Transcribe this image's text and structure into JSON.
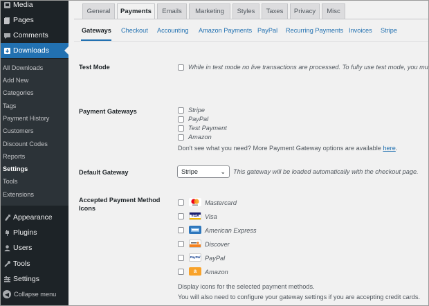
{
  "sidebar": {
    "top": [
      {
        "label": "Media",
        "icon": "media-icon"
      },
      {
        "label": "Pages",
        "icon": "pages-icon"
      },
      {
        "label": "Comments",
        "icon": "comments-icon"
      },
      {
        "label": "Downloads",
        "icon": "downloads-icon",
        "active": true
      }
    ],
    "submenu": [
      "All Downloads",
      "Add New",
      "Categories",
      "Tags",
      "Payment History",
      "Customers",
      "Discount Codes",
      "Reports",
      "Settings",
      "Tools",
      "Extensions"
    ],
    "current_submenu": "Settings",
    "bottom": [
      {
        "label": "Appearance",
        "icon": "appearance-icon"
      },
      {
        "label": "Plugins",
        "icon": "plugins-icon"
      },
      {
        "label": "Users",
        "icon": "users-icon"
      },
      {
        "label": "Tools",
        "icon": "tools-icon"
      },
      {
        "label": "Settings",
        "icon": "settings-icon"
      }
    ],
    "collapse_label": "Collapse menu"
  },
  "tabs": [
    "General",
    "Payments",
    "Emails",
    "Marketing",
    "Styles",
    "Taxes",
    "Privacy",
    "Misc"
  ],
  "active_tab": "Payments",
  "subtabs": [
    "Gateways",
    "Checkout",
    "Accounting",
    "Amazon Payments",
    "PayPal",
    "Recurring Payments",
    "Invoices",
    "Stripe"
  ],
  "active_subtab": "Gateways",
  "test_mode": {
    "label": "Test Mode",
    "description": "While in test mode no live transactions are processed. To fully use test mode, you must h"
  },
  "payment_gateways": {
    "label": "Payment Gateways",
    "options": [
      "Stripe",
      "PayPal",
      "Test Payment",
      "Amazon"
    ],
    "help_text": "Don't see what you need? More Payment Gateway options are available ",
    "help_link": "here",
    "help_end": "."
  },
  "default_gateway": {
    "label": "Default Gateway",
    "value": "Stripe",
    "description": "This gateway will be loaded automatically with the checkout page."
  },
  "accepted_icons": {
    "label_line1": "Accepted Payment Method",
    "label_line2": "Icons",
    "options": [
      {
        "label": "Mastercard",
        "icon": "mastercard-icon"
      },
      {
        "label": "Visa",
        "icon": "visa-icon"
      },
      {
        "label": "American Express",
        "icon": "amex-icon"
      },
      {
        "label": "Discover",
        "icon": "discover-icon"
      },
      {
        "label": "PayPal",
        "icon": "paypal-icon"
      },
      {
        "label": "Amazon",
        "icon": "amazon-icon"
      }
    ],
    "note1": "Display icons for the selected payment methods.",
    "note2": "You will also need to configure your gateway settings if you are accepting credit cards."
  },
  "card_text": {
    "visa": "VISA",
    "paypal": "PayPal",
    "amazon": "a"
  },
  "colors": {
    "sidebar": "#1d2327",
    "submenu": "#2c3338",
    "accent": "#2271b1"
  }
}
